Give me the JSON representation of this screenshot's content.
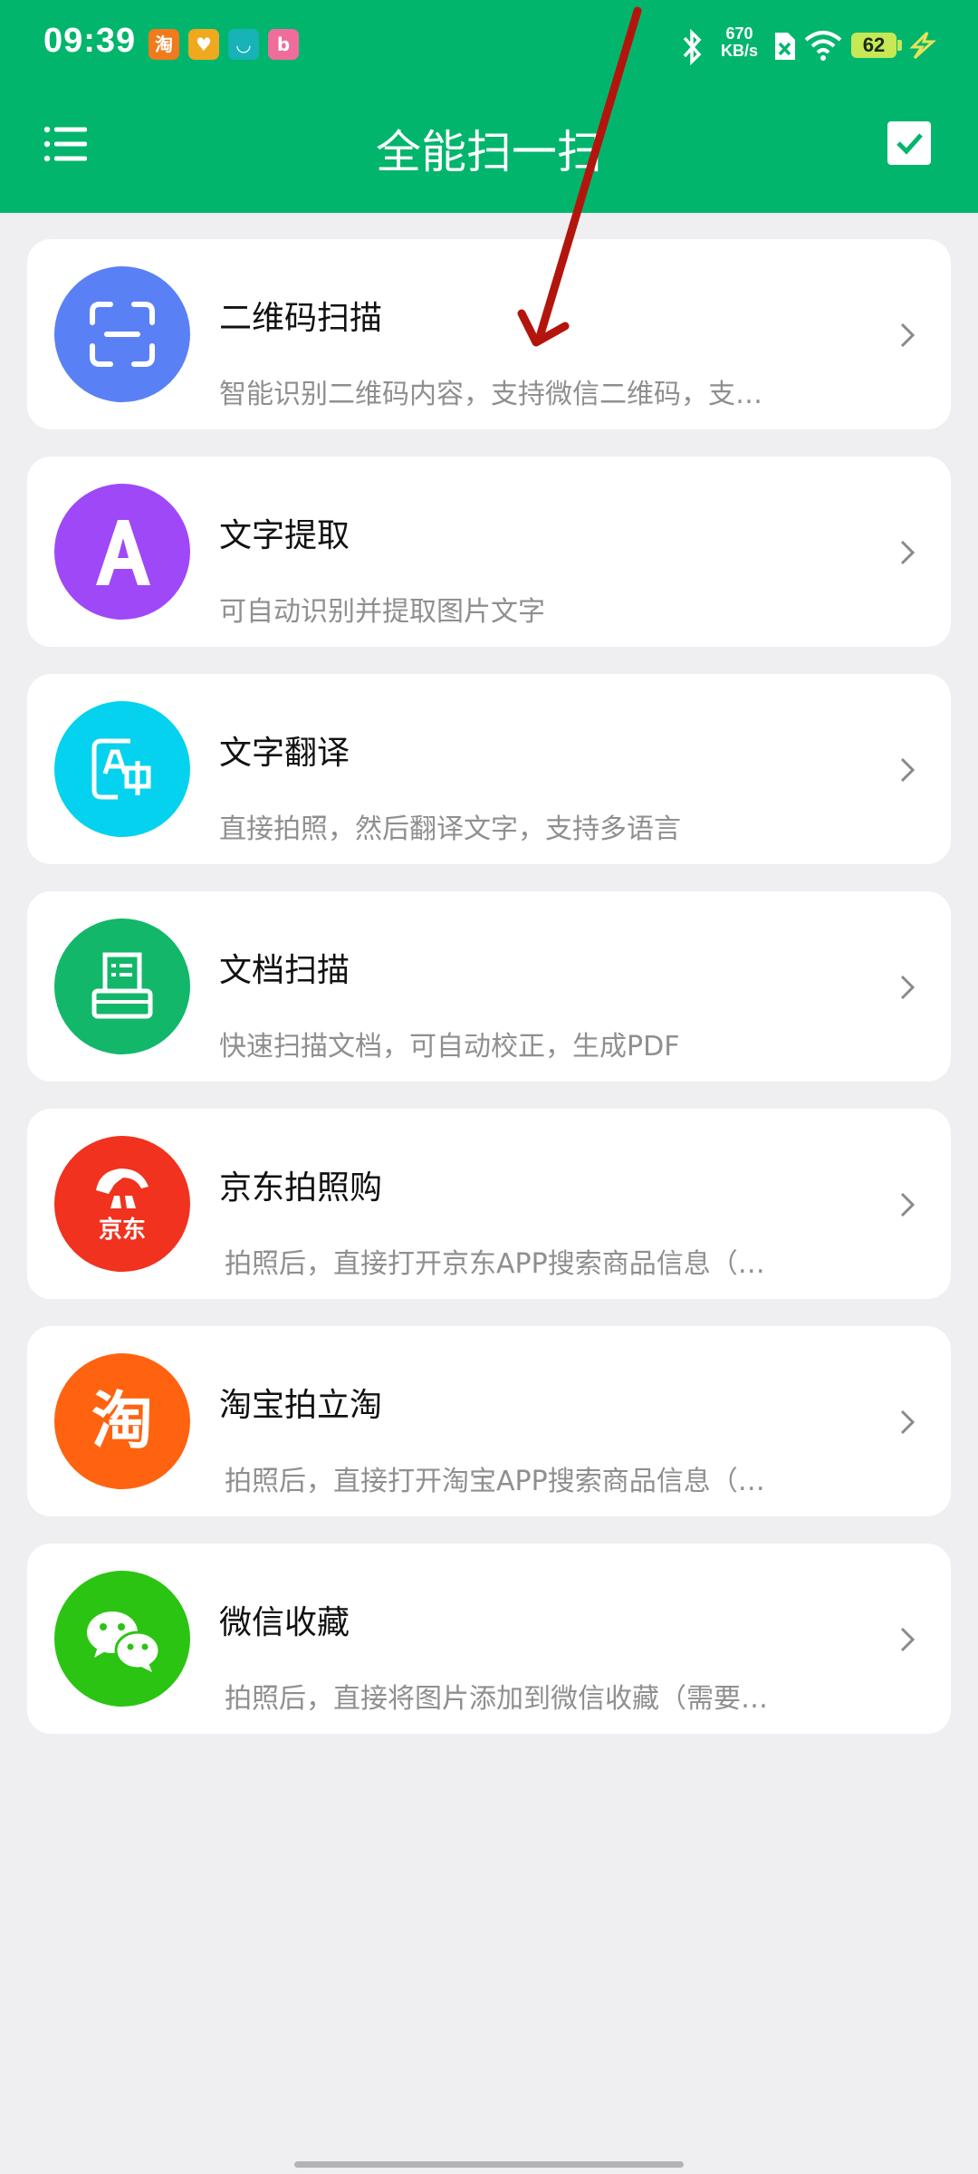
{
  "status_bar": {
    "time": "09:39",
    "speed_value": "670",
    "speed_unit": "KB/s",
    "battery": "62",
    "notification_icons": [
      "taobao-icon",
      "heart-app-icon",
      "shield-app-icon",
      "bilibili-icon"
    ]
  },
  "header": {
    "title": "全能扫一扫"
  },
  "colors": {
    "header_bg": "#02b56c",
    "page_bg": "#efeff2",
    "qr": "#5a80f6",
    "text_extract": "#9f48f8",
    "translate": "#04d2ee",
    "document": "#12b76a",
    "jd": "#f0321e",
    "taobao": "#ff6310",
    "wechat": "#2bc412",
    "annotation_arrow": "#b3150d"
  },
  "items": [
    {
      "title": "二维码扫描",
      "desc": "智能识别二维码内容，支持微信二维码，支…",
      "icon": "qr-scan-icon"
    },
    {
      "title": "文字提取",
      "desc": "可自动识别并提取图片文字",
      "icon": "letter-a-icon"
    },
    {
      "title": "文字翻译",
      "desc": "直接拍照，然后翻译文字，支持多语言",
      "icon": "translate-icon"
    },
    {
      "title": "文档扫描",
      "desc": "快速扫描文档，可自动校正，生成PDF",
      "icon": "document-scan-icon"
    },
    {
      "title": "京东拍照购",
      "desc": "拍照后，直接打开京东APP搜索商品信息（…",
      "icon": "jd-logo-icon",
      "logo_text": "京东"
    },
    {
      "title": "淘宝拍立淘",
      "desc": "拍照后，直接打开淘宝APP搜索商品信息（…",
      "icon": "taobao-logo-icon",
      "logo_text": "淘"
    },
    {
      "title": "微信收藏",
      "desc": "拍照后，直接将图片添加到微信收藏（需要…",
      "icon": "wechat-logo-icon"
    }
  ]
}
